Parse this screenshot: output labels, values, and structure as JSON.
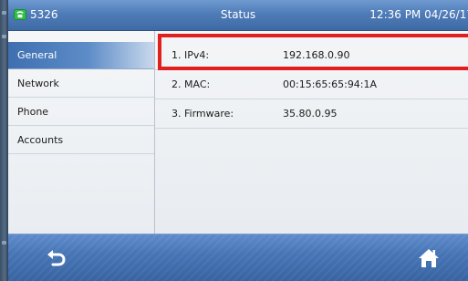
{
  "status_bar": {
    "line_icon": "phone-handset-icon",
    "extension": "5326",
    "title": "Status",
    "clock": "12:36 PM 04/26/17"
  },
  "sidebar": {
    "items": [
      {
        "label": "General",
        "active": true
      },
      {
        "label": "Network",
        "active": false
      },
      {
        "label": "Phone",
        "active": false
      },
      {
        "label": "Accounts",
        "active": false
      }
    ]
  },
  "status_info": {
    "rows": [
      {
        "label": "1. IPv4:",
        "value": "192.168.0.90"
      },
      {
        "label": "2. MAC:",
        "value": "00:15:65:65:94:1A"
      },
      {
        "label": "3. Firmware:",
        "value": "35.80.0.95"
      }
    ]
  },
  "soft_keys": {
    "back_icon": "back-arrow-icon",
    "home_icon": "home-icon"
  },
  "colors": {
    "accent": "#4f7cb8",
    "highlight": "#e0201e",
    "active_item": "#3f6fb0"
  }
}
